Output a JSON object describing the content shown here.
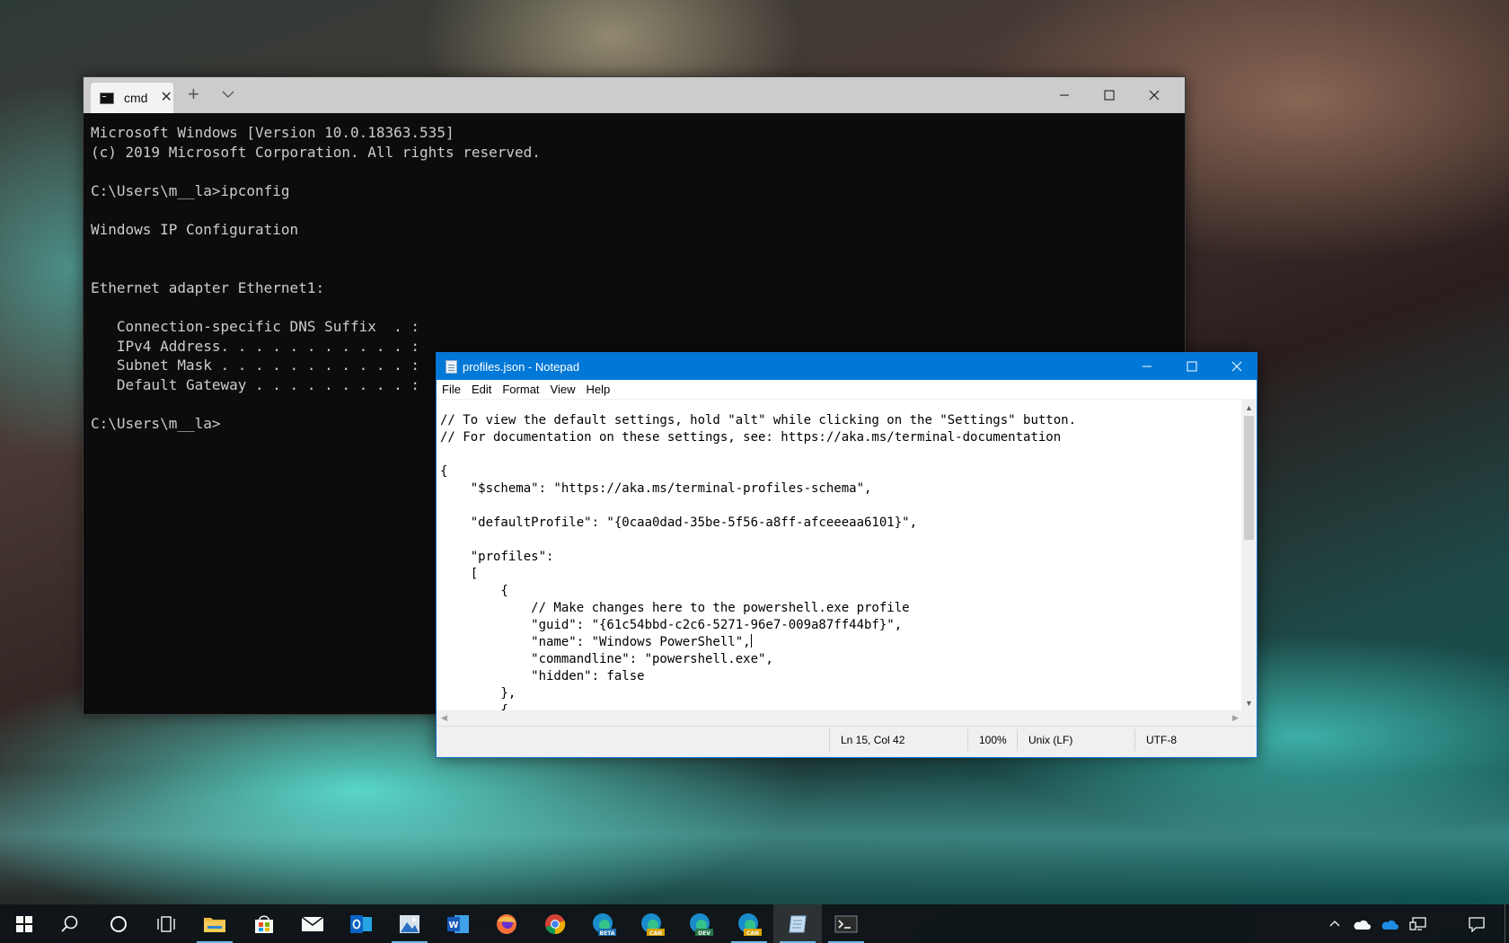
{
  "terminal": {
    "tab_label": "cmd",
    "lines": [
      "Microsoft Windows [Version 10.0.18363.535]",
      "(c) 2019 Microsoft Corporation. All rights reserved.",
      "",
      "C:\\Users\\m__la>ipconfig",
      "",
      "Windows IP Configuration",
      "",
      "",
      "Ethernet adapter Ethernet1:",
      "",
      "   Connection-specific DNS Suffix  . :",
      "   IPv4 Address. . . . . . . . . . . :",
      "   Subnet Mask . . . . . . . . . . . :",
      "   Default Gateway . . . . . . . . . :",
      "",
      "C:\\Users\\m__la>"
    ]
  },
  "notepad": {
    "title": "profiles.json - Notepad",
    "menu": [
      "File",
      "Edit",
      "Format",
      "View",
      "Help"
    ],
    "lines": [
      "// To view the default settings, hold \"alt\" while clicking on the \"Settings\" button.",
      "// For documentation on these settings, see: https://aka.ms/terminal-documentation",
      "",
      "{",
      "    \"$schema\": \"https://aka.ms/terminal-profiles-schema\",",
      "",
      "    \"defaultProfile\": \"{0caa0dad-35be-5f56-a8ff-afceeeaa6101}\",",
      "",
      "    \"profiles\":",
      "    [",
      "        {",
      "            // Make changes here to the powershell.exe profile",
      "            \"guid\": \"{61c54bbd-c2c6-5271-96e7-009a87ff44bf}\",",
      "            \"name\": \"Windows PowerShell\",",
      "            \"commandline\": \"powershell.exe\",",
      "            \"hidden\": false",
      "        },",
      "        {"
    ],
    "caret_line": 13,
    "status": {
      "position": "Ln 15, Col 42",
      "zoom": "100%",
      "line_ending": "Unix (LF)",
      "encoding": "UTF-8"
    }
  },
  "taskbar": {
    "items": [
      "start-icon",
      "search-icon",
      "cortana-icon",
      "task-view-icon",
      "file-explorer-icon",
      "microsoft-store-icon",
      "mail-icon",
      "outlook-icon",
      "photos-icon",
      "word-icon",
      "firefox-icon",
      "chrome-icon",
      "edge-beta-icon",
      "edge-canary-icon",
      "edge-dev-icon",
      "edge-canary-2-icon",
      "notepad-icon",
      "terminal-icon"
    ],
    "edge_badges": {
      "beta": "BETA",
      "dev": "DEV",
      "can": "CAN"
    },
    "tray": [
      "chevron-up-icon",
      "onedrive-personal-icon",
      "onedrive-business-icon",
      "network-icon",
      "notifications-icon"
    ]
  }
}
